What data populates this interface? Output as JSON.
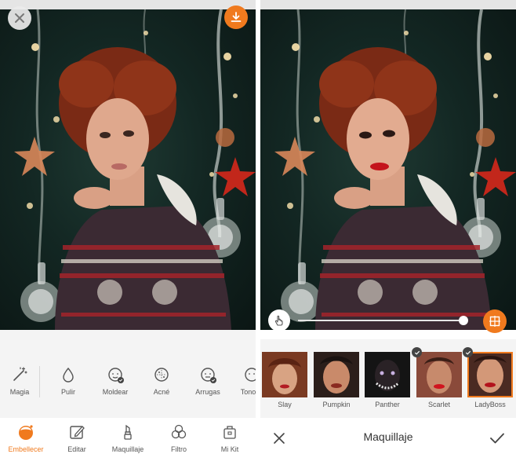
{
  "left": {
    "tools": [
      {
        "label": "Magia",
        "icon": "magic-wand-icon"
      },
      {
        "label": "Pulir",
        "icon": "drop-icon"
      },
      {
        "label": "Moldear",
        "icon": "face-shape-icon"
      },
      {
        "label": "Acné",
        "icon": "acne-face-icon"
      },
      {
        "label": "Arrugas",
        "icon": "wrinkles-face-icon"
      },
      {
        "label": "Tono D",
        "icon": "skin-tone-icon"
      }
    ],
    "nav": [
      {
        "label": "Embellecer",
        "icon": "beautify-face-icon"
      },
      {
        "label": "Editar",
        "icon": "edit-pencil-icon"
      },
      {
        "label": "Maquillaje",
        "icon": "lipstick-icon"
      },
      {
        "label": "Filtro",
        "icon": "filter-circles-icon"
      },
      {
        "label": "Mi Kit",
        "icon": "kit-box-icon"
      }
    ]
  },
  "right": {
    "slider_level": 0.96,
    "presets": [
      {
        "label": "Slay",
        "selected": false,
        "applied": false
      },
      {
        "label": "Pumpkin",
        "selected": false,
        "applied": false
      },
      {
        "label": "Panther",
        "selected": false,
        "applied": false
      },
      {
        "label": "Scarlet",
        "selected": false,
        "applied": true
      },
      {
        "label": "LadyBoss",
        "selected": true,
        "applied": true
      }
    ],
    "title": "Maquillaje"
  },
  "colors": {
    "accent": "#f07a1e",
    "background": "#f4f4f4",
    "text": "#555555"
  }
}
